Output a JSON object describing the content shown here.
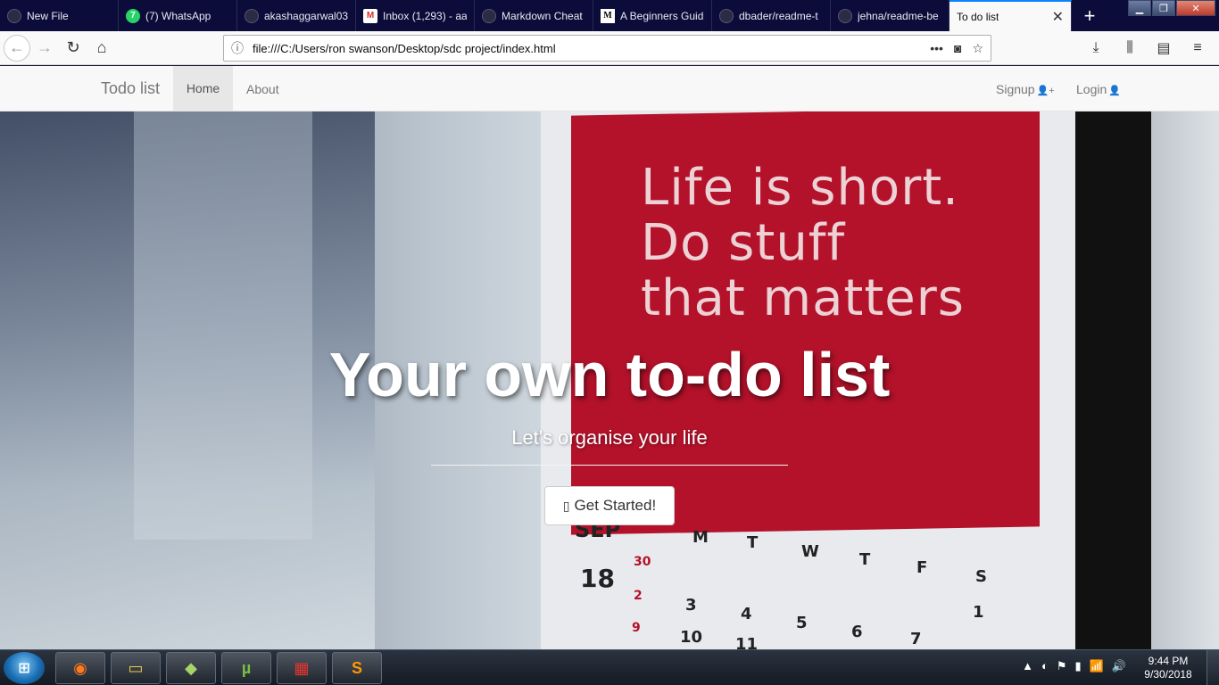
{
  "browser": {
    "tabs": [
      {
        "label": "New File",
        "icon": "github-icon"
      },
      {
        "label": "(7) WhatsApp",
        "icon": "whatsapp-icon",
        "badge": "7"
      },
      {
        "label": "akashaggarwal03",
        "icon": "github-icon"
      },
      {
        "label": "Inbox (1,293) - aa",
        "icon": "gmail-icon"
      },
      {
        "label": "Markdown Cheat",
        "icon": "github-icon"
      },
      {
        "label": "A Beginners Guid",
        "icon": "medium-icon"
      },
      {
        "label": "dbader/readme-t",
        "icon": "github-icon"
      },
      {
        "label": "jehna/readme-be",
        "icon": "github-icon"
      },
      {
        "label": "To do list",
        "icon": "",
        "active": true
      }
    ],
    "new_tab_glyph": "+",
    "url": "file:///C:/Users/ron swanson/Desktop/sdc project/index.html"
  },
  "navbar": {
    "brand": "Todo list",
    "home": "Home",
    "about": "About",
    "signup": "Signup",
    "login": "Login"
  },
  "hero": {
    "title": "Your own to-do list",
    "subtitle": "Let's organise your life",
    "cta": "Get Started!",
    "background_quote": [
      "Life is short.",
      "Do stuff",
      "that matters"
    ],
    "calendar": {
      "month": "SEP",
      "day": "18",
      "weekdays": [
        "M",
        "T",
        "W",
        "T",
        "F",
        "S"
      ],
      "dates_red": [
        "30",
        "2",
        "9"
      ],
      "dates": [
        "3",
        "4",
        "5",
        "6",
        "7",
        "1",
        "10",
        "11"
      ]
    }
  },
  "taskbar": {
    "clock_time": "9:44 PM",
    "clock_date": "9/30/2018"
  },
  "colors": {
    "accent_tab": "#0a84ff",
    "tab_strip": "#0c0c3a",
    "calendar_red": "#b3122a"
  }
}
